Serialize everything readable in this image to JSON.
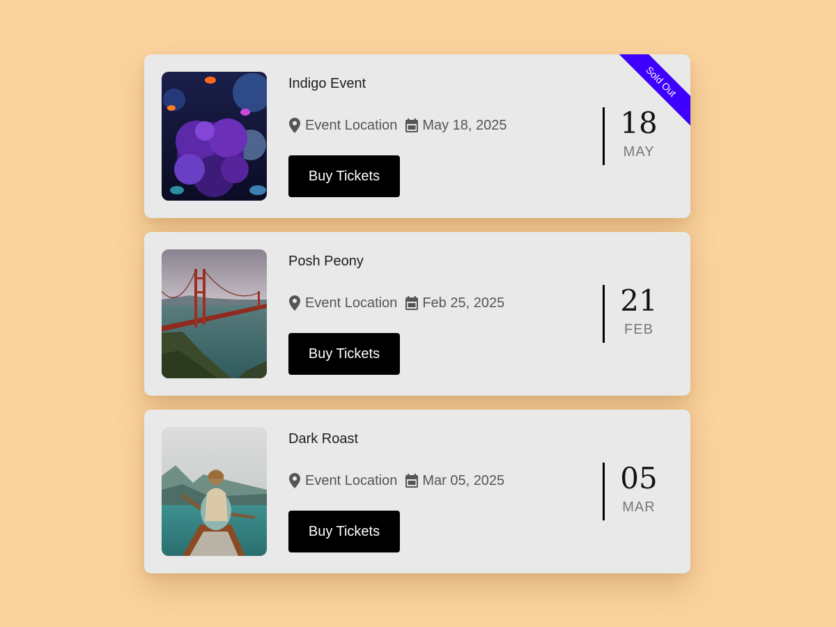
{
  "events": [
    {
      "title": "Indigo Event",
      "location": "Event Location",
      "date": "May 18, 2025",
      "button_label": "Buy Tickets",
      "day": "18",
      "month": "MAY",
      "ribbon": "Sold Out",
      "image": "coral-reef-photo"
    },
    {
      "title": "Posh Peony",
      "location": "Event Location",
      "date": "Feb 25, 2025",
      "button_label": "Buy Tickets",
      "day": "21",
      "month": "FEB",
      "image": "golden-gate-bridge-photo"
    },
    {
      "title": "Dark Roast",
      "location": "Event Location",
      "date": "Mar 05, 2025",
      "button_label": "Buy Tickets",
      "day": "05",
      "month": "MAR",
      "image": "canoe-lake-photo"
    }
  ],
  "colors": {
    "background": "#fbd39e",
    "card": "#e9e9e9",
    "button": "#000000",
    "ribbon": "#3d00ff"
  },
  "icons": {
    "location": "map-pin-icon",
    "date": "calendar-icon"
  }
}
